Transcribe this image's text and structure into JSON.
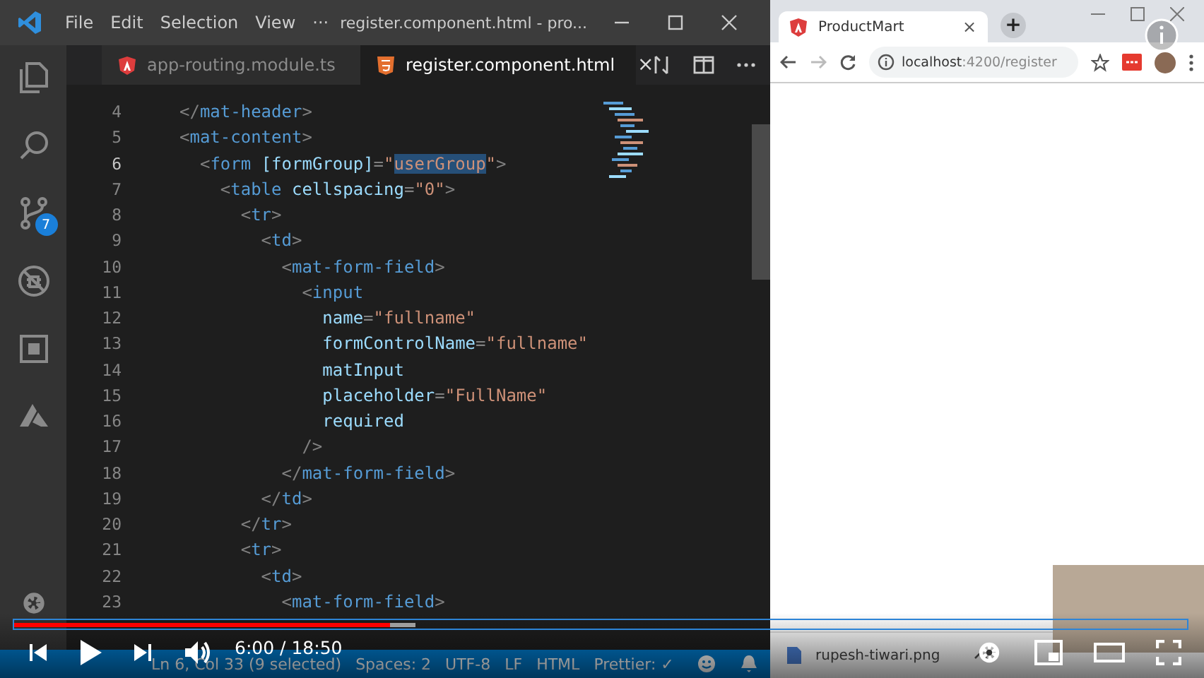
{
  "editor_window": {
    "menu": [
      "File",
      "Edit",
      "Selection",
      "View"
    ],
    "more": "···",
    "title": "register.component.html - pro...",
    "activity_bar": {
      "source_control_badge": "7"
    },
    "tabs": [
      {
        "label": "app-routing.module.ts",
        "kind": "angular",
        "selected": false
      },
      {
        "label": "register.component.html",
        "kind": "html",
        "selected": true,
        "close": "×"
      }
    ],
    "lines": [
      {
        "number": "4",
        "current": false,
        "tokens": [
          {
            "kind": "punct",
            "text": "</"
          },
          {
            "kind": "tag",
            "text": "mat-header"
          },
          {
            "kind": "punct",
            "text": ">"
          }
        ]
      },
      {
        "number": "5",
        "current": false,
        "tokens": [
          {
            "kind": "punct",
            "text": "<"
          },
          {
            "kind": "tag",
            "text": "mat-content"
          },
          {
            "kind": "punct",
            "text": ">"
          }
        ]
      },
      {
        "number": "6",
        "current": true,
        "tokens": [
          {
            "kind": "punct",
            "text": "  <"
          },
          {
            "kind": "tag",
            "text": "form"
          },
          {
            "kind": "attr",
            "text": " [formGroup]"
          },
          {
            "kind": "punct",
            "text": "="
          },
          {
            "kind": "string",
            "text": "\""
          },
          {
            "kind": "selection",
            "text": "userGroup"
          },
          {
            "kind": "string",
            "text": "\""
          },
          {
            "kind": "punct",
            "text": ">"
          }
        ]
      },
      {
        "number": "7",
        "current": false,
        "tokens": [
          {
            "kind": "punct",
            "text": "    <"
          },
          {
            "kind": "tag",
            "text": "table"
          },
          {
            "kind": "attr",
            "text": " cellspacing"
          },
          {
            "kind": "punct",
            "text": "="
          },
          {
            "kind": "string",
            "text": "\"0\""
          },
          {
            "kind": "punct",
            "text": ">"
          }
        ]
      },
      {
        "number": "8",
        "current": false,
        "tokens": [
          {
            "kind": "punct",
            "text": "      <"
          },
          {
            "kind": "tag",
            "text": "tr"
          },
          {
            "kind": "punct",
            "text": ">"
          }
        ]
      },
      {
        "number": "9",
        "current": false,
        "tokens": [
          {
            "kind": "punct",
            "text": "        <"
          },
          {
            "kind": "tag",
            "text": "td"
          },
          {
            "kind": "punct",
            "text": ">"
          }
        ]
      },
      {
        "number": "10",
        "current": false,
        "tokens": [
          {
            "kind": "punct",
            "text": "          <"
          },
          {
            "kind": "tag",
            "text": "mat-form-field"
          },
          {
            "kind": "punct",
            "text": ">"
          }
        ]
      },
      {
        "number": "11",
        "current": false,
        "tokens": [
          {
            "kind": "punct",
            "text": "            <"
          },
          {
            "kind": "tag",
            "text": "input"
          }
        ]
      },
      {
        "number": "12",
        "current": false,
        "tokens": [
          {
            "kind": "attr",
            "text": "              name"
          },
          {
            "kind": "punct",
            "text": "="
          },
          {
            "kind": "string",
            "text": "\"fullname\""
          }
        ]
      },
      {
        "number": "13",
        "current": false,
        "tokens": [
          {
            "kind": "attr",
            "text": "              formControlName"
          },
          {
            "kind": "punct",
            "text": "="
          },
          {
            "kind": "string",
            "text": "\"fullname\""
          }
        ]
      },
      {
        "number": "14",
        "current": false,
        "tokens": [
          {
            "kind": "attr",
            "text": "              matInput"
          }
        ]
      },
      {
        "number": "15",
        "current": false,
        "tokens": [
          {
            "kind": "attr",
            "text": "              placeholder"
          },
          {
            "kind": "punct",
            "text": "="
          },
          {
            "kind": "string",
            "text": "\"FullName\""
          }
        ]
      },
      {
        "number": "16",
        "current": false,
        "tokens": [
          {
            "kind": "attr",
            "text": "              required"
          }
        ]
      },
      {
        "number": "17",
        "current": false,
        "tokens": [
          {
            "kind": "punct",
            "text": "            />"
          }
        ]
      },
      {
        "number": "18",
        "current": false,
        "tokens": [
          {
            "kind": "punct",
            "text": "          </"
          },
          {
            "kind": "tag",
            "text": "mat-form-field"
          },
          {
            "kind": "punct",
            "text": ">"
          }
        ]
      },
      {
        "number": "19",
        "current": false,
        "tokens": [
          {
            "kind": "punct",
            "text": "        </"
          },
          {
            "kind": "tag",
            "text": "td"
          },
          {
            "kind": "punct",
            "text": ">"
          }
        ]
      },
      {
        "number": "20",
        "current": false,
        "tokens": [
          {
            "kind": "punct",
            "text": "      </"
          },
          {
            "kind": "tag",
            "text": "tr"
          },
          {
            "kind": "punct",
            "text": ">"
          }
        ]
      },
      {
        "number": "21",
        "current": false,
        "tokens": [
          {
            "kind": "punct",
            "text": "      <"
          },
          {
            "kind": "tag",
            "text": "tr"
          },
          {
            "kind": "punct",
            "text": ">"
          }
        ]
      },
      {
        "number": "22",
        "current": false,
        "tokens": [
          {
            "kind": "punct",
            "text": "        <"
          },
          {
            "kind": "tag",
            "text": "td"
          },
          {
            "kind": "punct",
            "text": ">"
          }
        ]
      },
      {
        "number": "23",
        "current": false,
        "tokens": [
          {
            "kind": "punct",
            "text": "          <"
          },
          {
            "kind": "tag",
            "text": "mat-form-field"
          },
          {
            "kind": "punct",
            "text": ">"
          }
        ]
      }
    ],
    "status_bar": [
      "Ln 6, Col 33 (9 selected)",
      "Spaces: 2",
      "UTF-8",
      "LF",
      "HTML",
      "Prettier: ✓"
    ]
  },
  "browser": {
    "tab": {
      "label": "ProductMart",
      "close": "×"
    },
    "new_tab": "+",
    "address": {
      "host": "localhost",
      "rest": ":4200/register"
    },
    "download": {
      "file": "rupesh-tiwari.png"
    }
  },
  "player": {
    "progress": {
      "level": 0.32
    },
    "buffer": {
      "level": 0.342
    },
    "time": "6:00 / 18:50"
  }
}
